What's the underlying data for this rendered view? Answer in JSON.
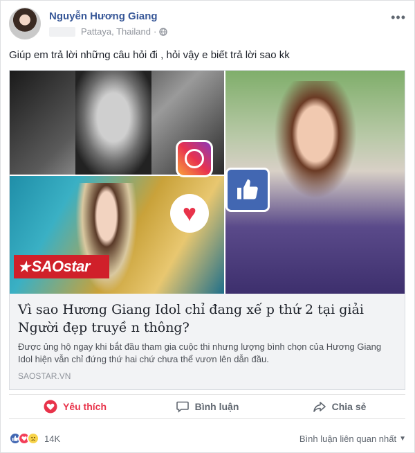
{
  "post": {
    "author": "Nguyễn Hương Giang",
    "location": "Pattaya, Thailand",
    "privacy_icon": "globe-icon",
    "status_text": "Giúp em trả lời những câu hỏi đi , hỏi vậy e biết trả lời sao kk"
  },
  "link": {
    "watermark": "SAOstar",
    "title": "Vì sao Hương Giang Idol chỉ đang xế p thứ 2 tại giải Người đẹp truyề n thông?",
    "description": "Được ủng hộ ngay khi bắt đầu tham gia cuộc thi nhưng lượng bình chọn của Hương Giang Idol hiện vẫn chỉ đứng thứ hai chứ chưa thể vươn lên dẫn đầu.",
    "domain": "SAOSTAR.VN"
  },
  "actions": {
    "love_label": "Yêu thích",
    "comment_label": "Bình luận",
    "share_label": "Chia sẻ"
  },
  "reactions": {
    "count": "14K",
    "sort_label": "Bình luận liên quan nhất"
  },
  "colors": {
    "link_blue": "#385898",
    "love_red": "#e8334a",
    "like_blue": "#4267b2"
  }
}
